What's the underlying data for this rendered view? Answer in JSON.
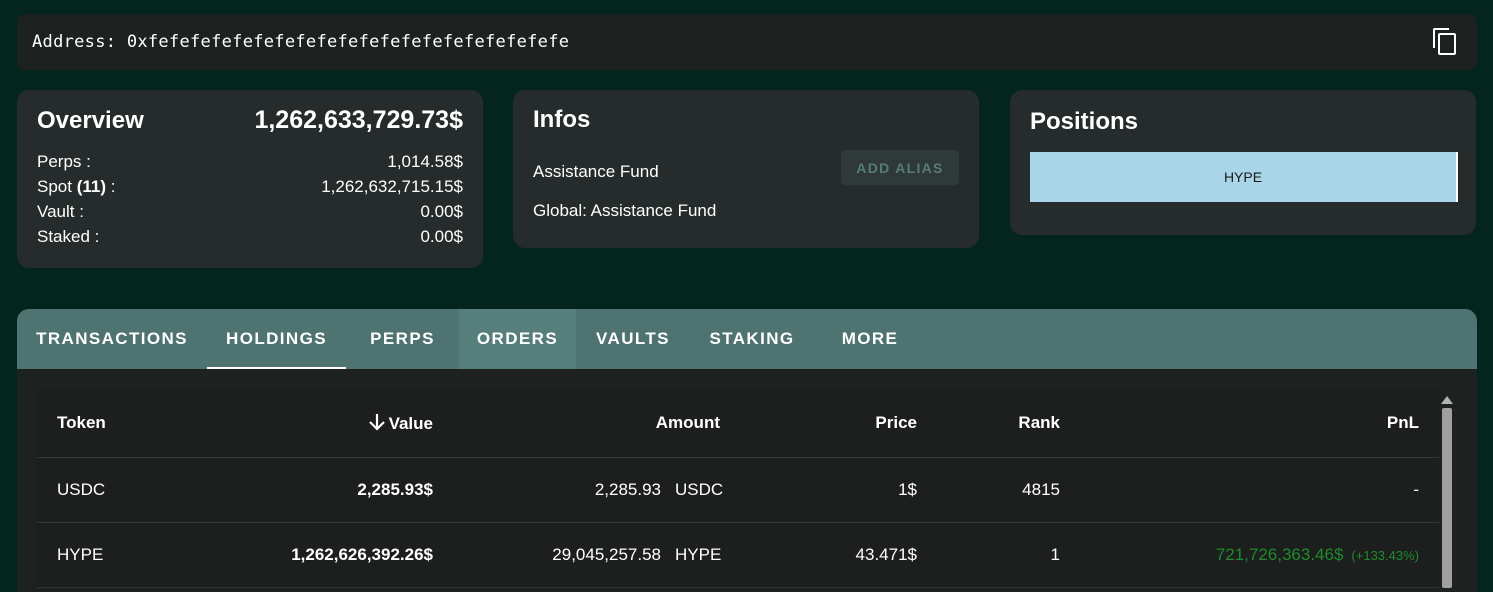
{
  "address": {
    "text": "Address: 0xfefefefefefefefefefefefefefefefefefefefe",
    "copy_icon": "copy-icon"
  },
  "overview": {
    "title": "Overview",
    "total": "1,262,633,729.73$",
    "rows": [
      {
        "label": "Perps :",
        "value": "1,014.58$"
      },
      {
        "label_prefix": "Spot ",
        "label_count": "(11)",
        "label_suffix": " :",
        "value": "1,262,632,715.15$"
      },
      {
        "label": "Vault :",
        "value": "0.00$"
      },
      {
        "label": "Staked :",
        "value": "0.00$"
      }
    ]
  },
  "infos": {
    "title": "Infos",
    "name": "Assistance Fund",
    "add_alias_label": "ADD ALIAS",
    "global": "Global: Assistance Fund"
  },
  "positions": {
    "title": "Positions",
    "items": [
      {
        "label": "HYPE",
        "share": 1.0,
        "color": "#a9d5e8"
      }
    ]
  },
  "tabs": [
    {
      "label": "TRANSACTIONS",
      "active": false
    },
    {
      "label": "HOLDINGS",
      "active": true
    },
    {
      "label": "PERPS",
      "active": false
    },
    {
      "label": "ORDERS",
      "active": false,
      "hover": true
    },
    {
      "label": "VAULTS",
      "active": false
    },
    {
      "label": "STAKING",
      "active": false
    },
    {
      "label": "MORE",
      "active": false
    }
  ],
  "table": {
    "headers": {
      "token": "Token",
      "value": "Value",
      "amount": "Amount",
      "price": "Price",
      "rank": "Rank",
      "pnl": "PnL"
    },
    "sort_icon": "arrow-down-icon",
    "rows": [
      {
        "token": "USDC",
        "value": "2,285.93$",
        "amount": "2,285.93",
        "amount_symbol": "USDC",
        "price": "1$",
        "rank": "4815",
        "pnl": "-",
        "pnl_pct": ""
      },
      {
        "token": "HYPE",
        "value": "1,262,626,392.26$",
        "amount": "29,045,257.58",
        "amount_symbol": "HYPE",
        "price": "43.471$",
        "rank": "1",
        "pnl": "721,726,363.46$",
        "pnl_pct": "(+133.43%)"
      }
    ]
  },
  "colors": {
    "background": "#04241e",
    "tab_bar": "#4e7370",
    "pnl_positive": "#1f8b2c"
  }
}
